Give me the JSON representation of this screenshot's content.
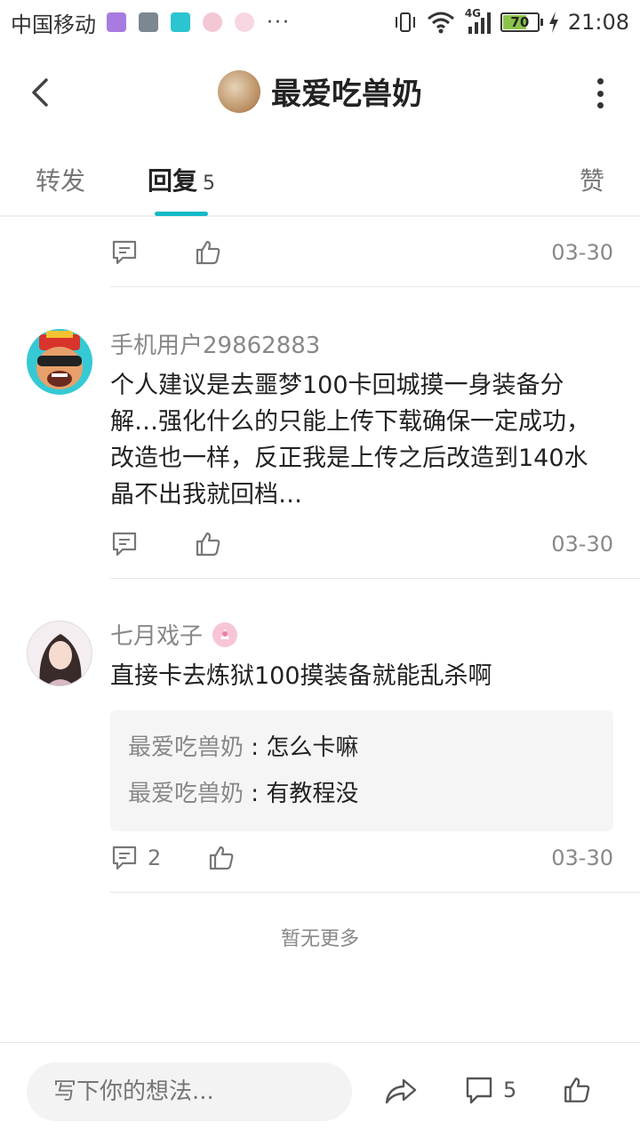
{
  "status_bar": {
    "carrier": "中国移动",
    "network": "4G",
    "battery": "70",
    "time": "21:08"
  },
  "header": {
    "title": "最爱吃兽奶"
  },
  "tabs": {
    "forward": "转发",
    "reply": "回复",
    "reply_count": "5",
    "like": "赞"
  },
  "posts": [
    {
      "date": "03-30"
    },
    {
      "username": "手机用户29862883",
      "content": "个人建议是去噩梦100卡回城摸一身装备分解…强化什么的只能上传下载确保一定成功，改造也一样，反正我是上传之后改造到140水晶不出我就回档…",
      "date": "03-30"
    },
    {
      "username": "七月戏子",
      "content": "直接卡去炼狱100摸装备就能乱杀啊",
      "replies": [
        {
          "name": "最爱吃兽奶",
          "sep": " : ",
          "text": "怎么卡嘛"
        },
        {
          "name": "最爱吃兽奶",
          "sep": " : ",
          "text": "有教程没"
        }
      ],
      "comment_count": "2",
      "date": "03-30"
    }
  ],
  "footer": {
    "no_more": "暂无更多"
  },
  "bottom_bar": {
    "placeholder": "写下你的想法...",
    "comment_count": "5"
  },
  "colors": {
    "accent": "#14b9c8"
  }
}
